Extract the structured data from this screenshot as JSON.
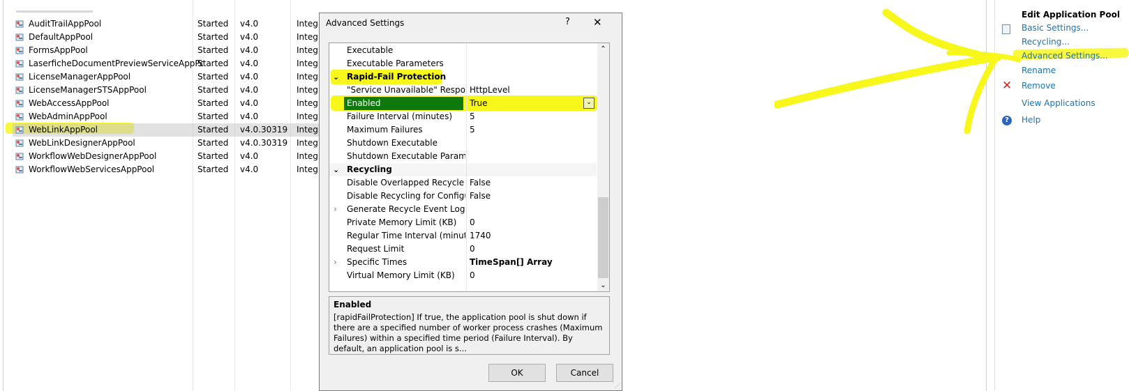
{
  "pools": [
    {
      "name": "AuditTrailAppPool",
      "status": "Started",
      "clr": "v4.0",
      "mode": "Integra"
    },
    {
      "name": "DefaultAppPool",
      "status": "Started",
      "clr": "v4.0",
      "mode": "Integra"
    },
    {
      "name": "FormsAppPool",
      "status": "Started",
      "clr": "v4.0",
      "mode": "Integra"
    },
    {
      "name": "LaserficheDocumentPreviewServiceAppPool",
      "status": "Started",
      "clr": "v4.0",
      "mode": "Integra"
    },
    {
      "name": "LicenseManagerAppPool",
      "status": "Started",
      "clr": "v4.0",
      "mode": "Integra"
    },
    {
      "name": "LicenseManagerSTSAppPool",
      "status": "Started",
      "clr": "v4.0",
      "mode": "Integra"
    },
    {
      "name": "WebAccessAppPool",
      "status": "Started",
      "clr": "v4.0",
      "mode": "Integra"
    },
    {
      "name": "WebAdminAppPool",
      "status": "Started",
      "clr": "v4.0",
      "mode": "Integra"
    },
    {
      "name": "WebLinkAppPool",
      "status": "Started",
      "clr": "v4.0.30319",
      "mode": "Integra"
    },
    {
      "name": "WebLinkDesignerAppPool",
      "status": "Started",
      "clr": "v4.0.30319",
      "mode": "Integra"
    },
    {
      "name": "WorkflowWebDesignerAppPool",
      "status": "Started",
      "clr": "v4.0",
      "mode": "Integra"
    },
    {
      "name": "WorkflowWebServicesAppPool",
      "status": "Started",
      "clr": "v4.0",
      "mode": "Integra"
    }
  ],
  "dialog": {
    "title": "Advanced Settings",
    "help_glyph": "?",
    "close_glyph": "✕",
    "rows": [
      {
        "kind": "prop",
        "name": "Executable",
        "value": ""
      },
      {
        "kind": "prop",
        "name": "Executable Parameters",
        "value": ""
      },
      {
        "kind": "cat",
        "name": "Rapid-Fail Protection",
        "value": ""
      },
      {
        "kind": "prop",
        "name": "\"Service Unavailable\" Response Type",
        "value": "HttpLevel"
      },
      {
        "kind": "selected",
        "name": "Enabled",
        "value": "True"
      },
      {
        "kind": "prop",
        "name": "Failure Interval (minutes)",
        "value": "5"
      },
      {
        "kind": "prop",
        "name": "Maximum Failures",
        "value": "5"
      },
      {
        "kind": "prop",
        "name": "Shutdown Executable",
        "value": ""
      },
      {
        "kind": "prop",
        "name": "Shutdown Executable Parameters",
        "value": ""
      },
      {
        "kind": "cat",
        "name": "Recycling",
        "value": ""
      },
      {
        "kind": "prop",
        "name": "Disable Overlapped Recycle",
        "value": "False"
      },
      {
        "kind": "prop",
        "name": "Disable Recycling for Configuration Changes",
        "value": "False"
      },
      {
        "kind": "expand",
        "name": "Generate Recycle Event Log Entry",
        "value": ""
      },
      {
        "kind": "prop",
        "name": "Private Memory Limit (KB)",
        "value": "0"
      },
      {
        "kind": "prop",
        "name": "Regular Time Interval (minutes)",
        "value": "1740"
      },
      {
        "kind": "prop",
        "name": "Request Limit",
        "value": "0"
      },
      {
        "kind": "expandbold",
        "name": "Specific Times",
        "value": "TimeSpan[] Array"
      },
      {
        "kind": "prop",
        "name": "Virtual Memory Limit (KB)",
        "value": "0"
      }
    ],
    "description_title": "Enabled",
    "description_text": "[rapidFailProtection] If true, the application pool is shut down if there are a specified number of worker process crashes (Maximum Failures) within a specified time period (Failure Interval).  By default, an application pool is s...",
    "ok_label": "OK",
    "cancel_label": "Cancel"
  },
  "actions": {
    "header": "Edit Application Pool",
    "basic_settings": "Basic Settings...",
    "recycling": "Recycling...",
    "advanced_settings": "Advanced Settings...",
    "rename": "Rename",
    "remove": "Remove",
    "view_applications": "View Applications",
    "help": "Help"
  },
  "colors": {
    "highlighter": "#f7f71c",
    "selection_green": "#0e7a0d",
    "link_blue": "#1a73b8",
    "remove_red": "#d9261c"
  }
}
